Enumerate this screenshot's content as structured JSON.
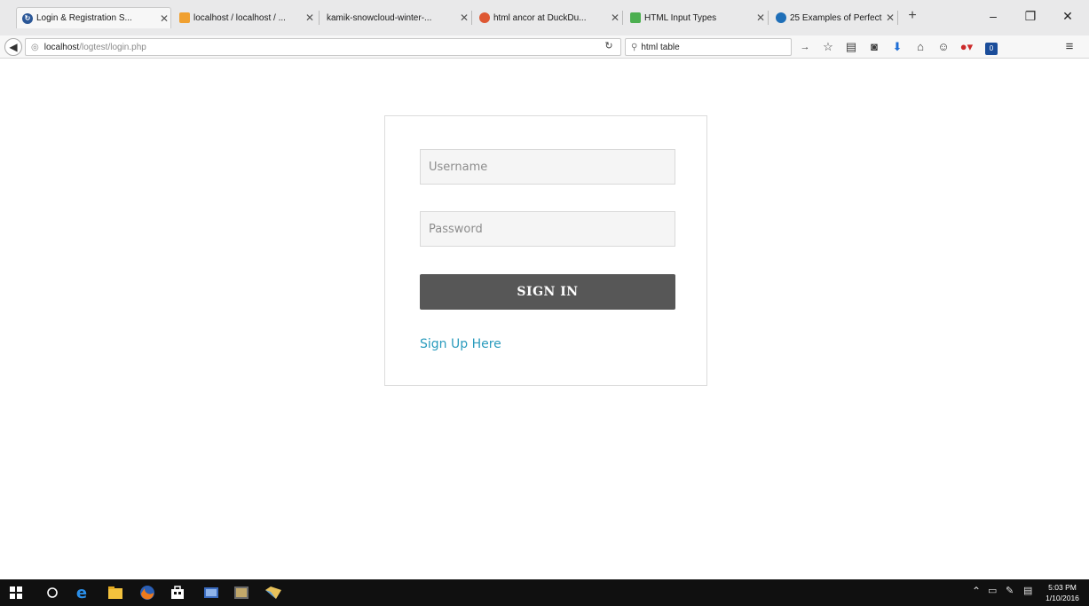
{
  "browser": {
    "tabs": [
      {
        "title": "Login & Registration S...",
        "favicon": "login-favicon",
        "color": "#2b5797",
        "active": true
      },
      {
        "title": "localhost / localhost / ...",
        "favicon": "phpmyadmin-favicon",
        "color": "#f0a030",
        "active": false
      },
      {
        "title": "kamik-snowcloud-winter-...",
        "favicon": "",
        "color": "",
        "active": false
      },
      {
        "title": "html ancor at DuckDu...",
        "favicon": "duckduckgo-favicon",
        "color": "#de5833",
        "active": false
      },
      {
        "title": "HTML Input Types",
        "favicon": "w3schools-favicon",
        "color": "#4caf50",
        "active": false
      },
      {
        "title": "25 Examples of Perfect...",
        "favicon": "blue-circle-favicon",
        "color": "#1f6fb8",
        "active": false
      }
    ],
    "url_host": "localhost",
    "url_path": "/logtest/login.php",
    "search_value": "html table",
    "window_controls": {
      "minimize": "–",
      "restore": "❐",
      "close": "✕"
    },
    "toolbar_icons": [
      "arrow-right-icon",
      "star-icon",
      "reading-list-icon",
      "pocket-icon",
      "download-icon",
      "home-icon",
      "chat-icon",
      "adblock-icon",
      "extension-icon",
      "menu-icon"
    ],
    "extension_badge": "0"
  },
  "login": {
    "username_placeholder": "Username",
    "password_placeholder": "Password",
    "signin_label": "SIGN IN",
    "signup_label": "Sign Up Here"
  },
  "colors": {
    "button_bg": "#575757",
    "link": "#2a9bbd",
    "field_bg": "#f5f5f5"
  },
  "taskbar": {
    "apps": [
      "windows-start-icon",
      "cortana-icon",
      "edge-icon",
      "file-explorer-icon",
      "firefox-icon",
      "store-icon",
      "app-icon",
      "media-icon",
      "folder-icon"
    ],
    "tray_icons": [
      "chevron-up-icon",
      "battery-icon",
      "pen-icon",
      "notification-icon"
    ],
    "time": "5:03 PM",
    "date": "1/10/2016"
  }
}
